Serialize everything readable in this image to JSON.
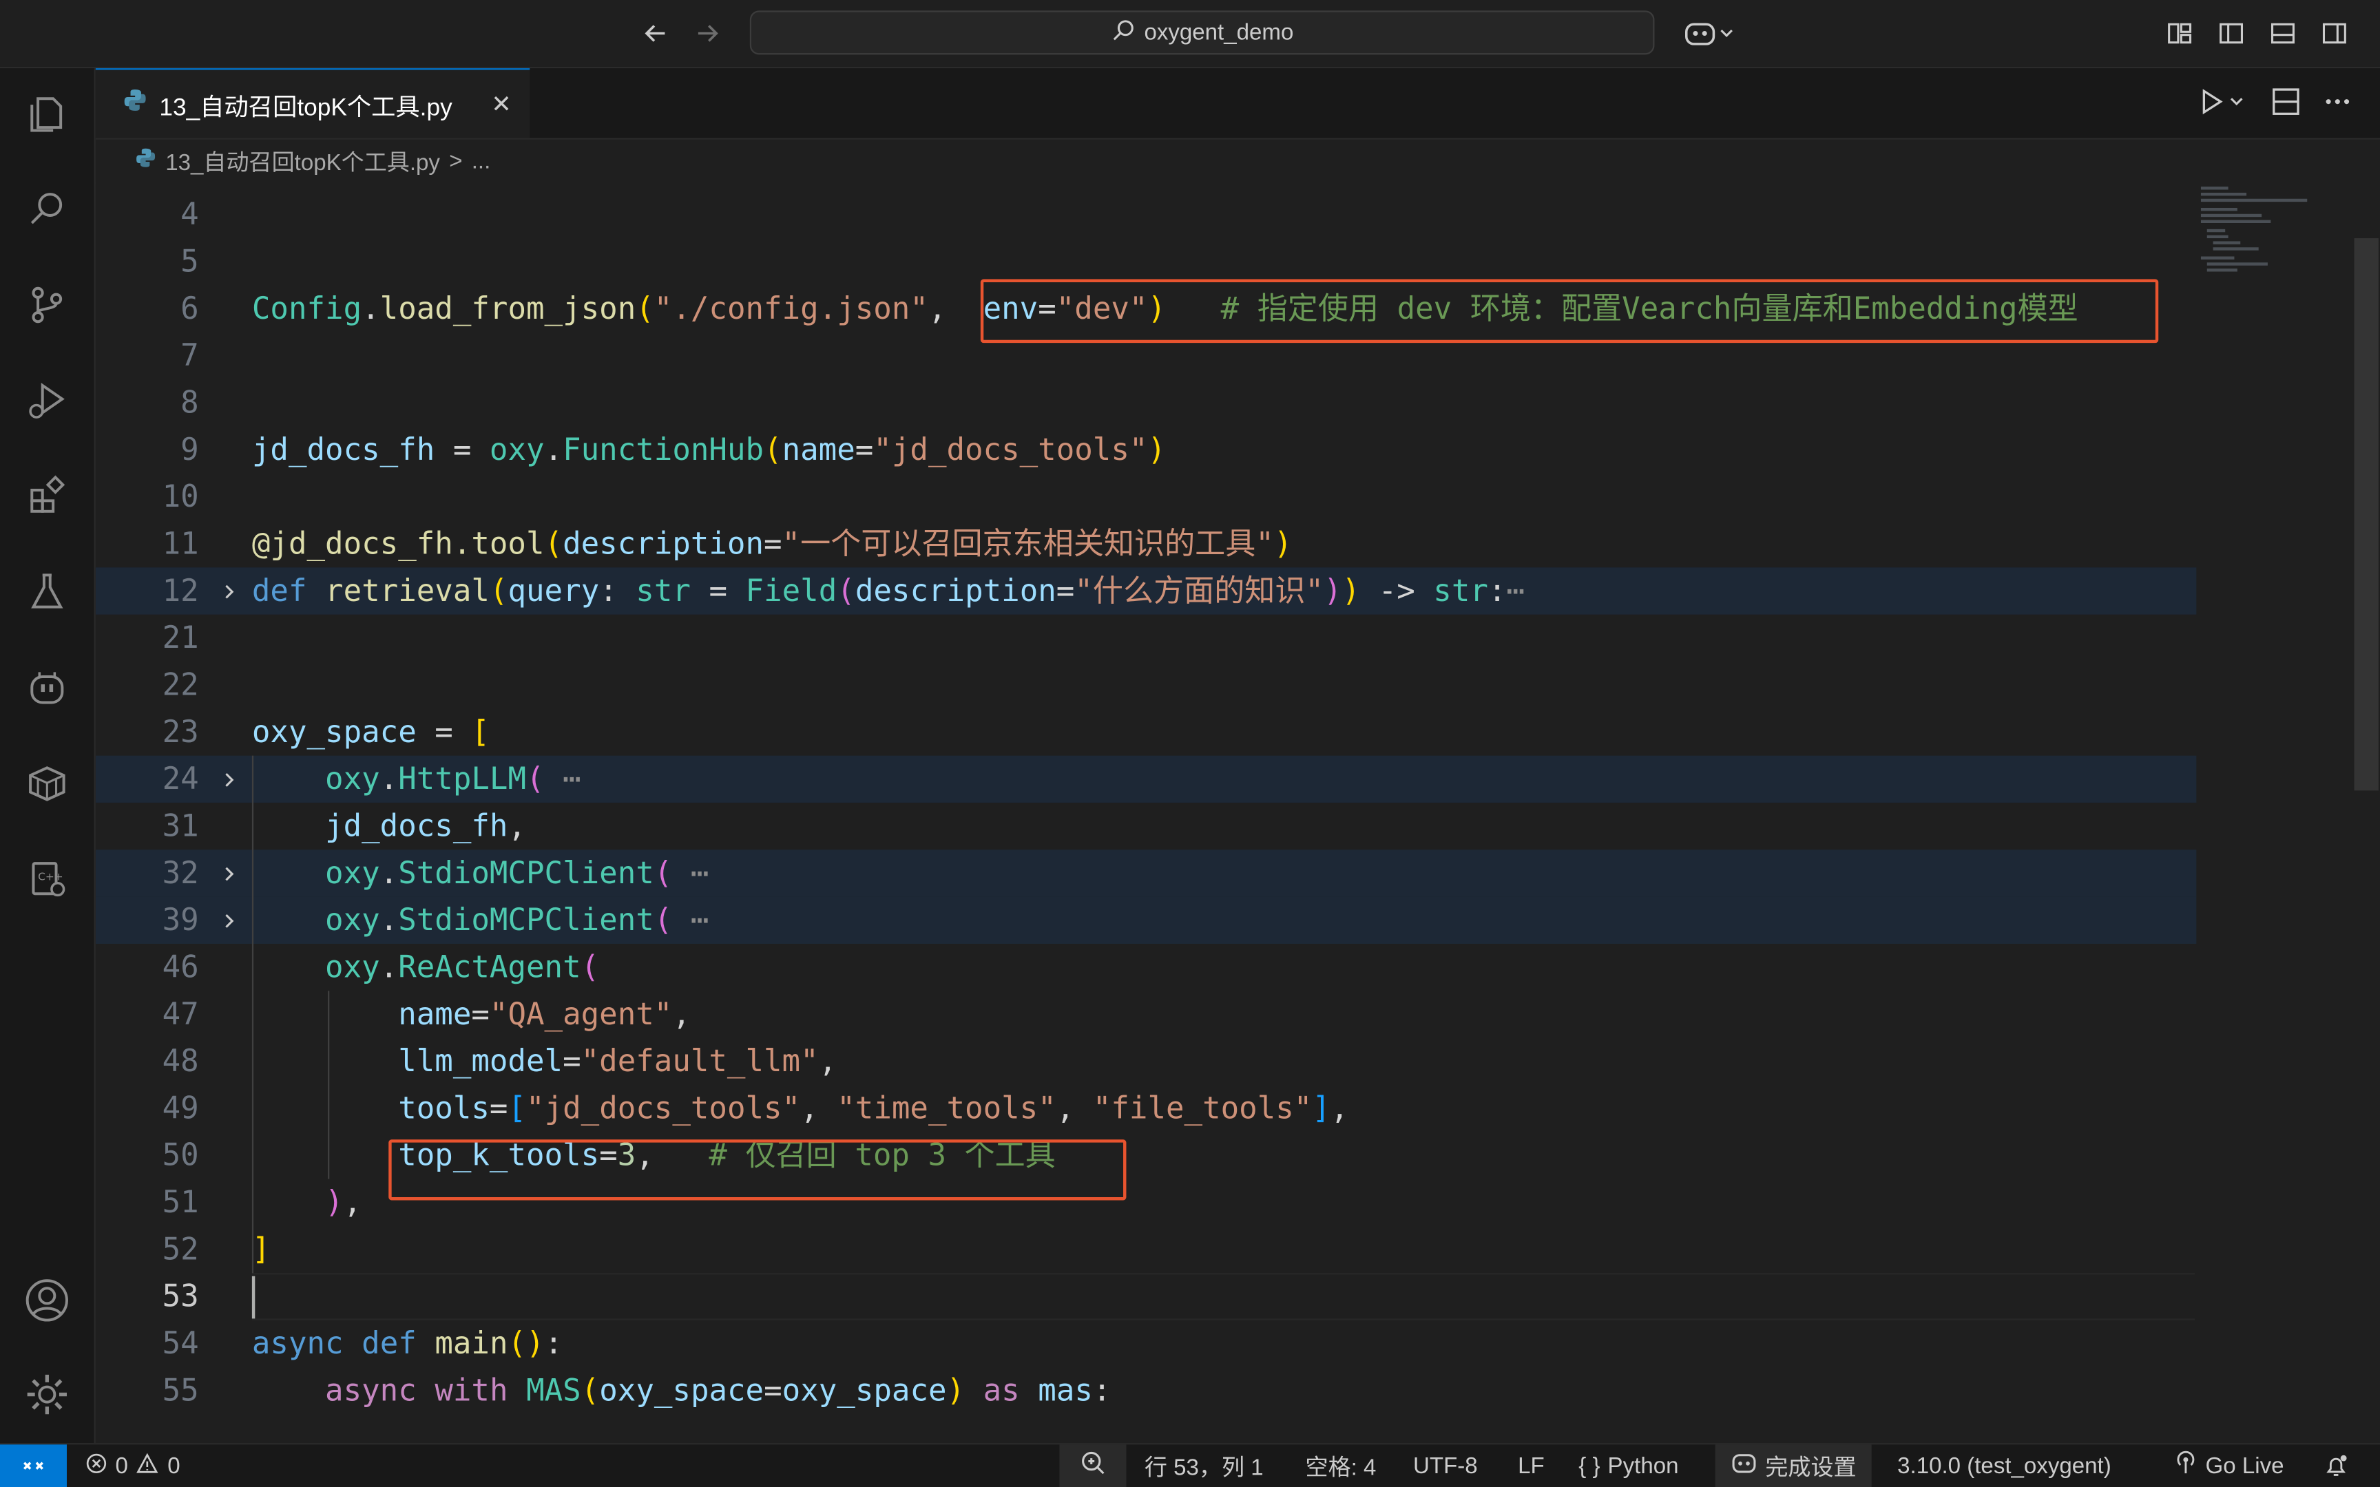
{
  "window": {
    "search_text": "oxygent_demo"
  },
  "tab": {
    "filename": "13_自动召回topK个工具.py",
    "close_glyph": "✕"
  },
  "breadcrumb": {
    "file": "13_自动召回topK个工具.py",
    "separator": ">",
    "more": "..."
  },
  "editor": {
    "lines": [
      {
        "num": "4"
      },
      {
        "num": "5"
      },
      {
        "num": "6"
      },
      {
        "num": "7"
      },
      {
        "num": "8"
      },
      {
        "num": "9"
      },
      {
        "num": "10"
      },
      {
        "num": "11"
      },
      {
        "num": "12"
      },
      {
        "num": "21"
      },
      {
        "num": "22"
      },
      {
        "num": "23"
      },
      {
        "num": "24"
      },
      {
        "num": "31"
      },
      {
        "num": "32"
      },
      {
        "num": "39"
      },
      {
        "num": "46"
      },
      {
        "num": "47"
      },
      {
        "num": "48"
      },
      {
        "num": "49"
      },
      {
        "num": "50"
      },
      {
        "num": "51"
      },
      {
        "num": "52"
      },
      {
        "num": "53"
      },
      {
        "num": "54"
      },
      {
        "num": "55"
      }
    ],
    "code": {
      "l6_cls": "Config",
      "l6_dot": ".",
      "l6_fn": "load_from_json",
      "l6_p": "(",
      "l6_str": "\"./config.json\"",
      "l6_comma": ", ",
      "l6_env": "env",
      "l6_eq": "=",
      "l6_dev": "\"dev\"",
      "l6_close": ")",
      "l6_comment": "# 指定使用 dev 环境：配置Vearch向量库和Embedding模型",
      "l9_var": "jd_docs_fh",
      "l9_eq": " = ",
      "l9_mod": "oxy",
      "l9_dot": ".",
      "l9_cls": "FunctionHub",
      "l9_p": "(",
      "l9_arg": "name",
      "l9_eq2": "=",
      "l9_str": "\"jd_docs_tools\"",
      "l9_close": ")",
      "l11_dec": "@jd_docs_fh.tool",
      "l11_p": "(",
      "l11_arg": "description",
      "l11_eq": "=",
      "l11_str": "\"一个可以召回京东相关知识的工具\"",
      "l11_close": ")",
      "l12_def": "def",
      "l12_fn": "retrieval",
      "l12_p": "(",
      "l12_arg": "query",
      "l12_colon": ": ",
      "l12_type": "str",
      "l12_eq": " = ",
      "l12_field": "Field",
      "l12_p2": "(",
      "l12_arg2": "description",
      "l12_eq2": "=",
      "l12_str": "\"什么方面的知识\"",
      "l12_c2": ")",
      "l12_c1": ")",
      "l12_arrow": " -> ",
      "l12_ret": "str",
      "l12_colon2": ":",
      "l12_dots": "⋯",
      "l23_var": "oxy_space",
      "l23_eq": " = ",
      "l23_br": "[",
      "l24_mod": "oxy",
      "l24_dot": ".",
      "l24_cls": "HttpLLM",
      "l24_p": "(",
      "l24_dots": "⋯",
      "l31_var": "jd_docs_fh",
      "l31_comma": ",",
      "l32_mod": "oxy",
      "l32_dot": ".",
      "l32_cls": "StdioMCPClient",
      "l32_p": "(",
      "l32_dots": "⋯",
      "l39_mod": "oxy",
      "l39_dot": ".",
      "l39_cls": "StdioMCPClient",
      "l39_p": "(",
      "l39_dots": "⋯",
      "l46_mod": "oxy",
      "l46_dot": ".",
      "l46_cls": "ReActAgent",
      "l46_p": "(",
      "l47_arg": "name",
      "l47_eq": "=",
      "l47_str": "\"QA_agent\"",
      "l47_comma": ",",
      "l48_arg": "llm_model",
      "l48_eq": "=",
      "l48_str": "\"default_llm\"",
      "l48_comma": ",",
      "l49_arg": "tools",
      "l49_eq": "=",
      "l49_br": "[",
      "l49_s1": "\"jd_docs_tools\"",
      "l49_c1": ", ",
      "l49_s2": "\"time_tools\"",
      "l49_c2": ", ",
      "l49_s3": "\"file_tools\"",
      "l49_br2": "]",
      "l49_comma": ",",
      "l50_arg": "top_k_tools",
      "l50_eq": "=",
      "l50_num": "3",
      "l50_comma": ",",
      "l50_comment": "# 仅召回 top 3 个工具",
      "l51_close": ")",
      "l51_comma": ",",
      "l52_br": "]",
      "l54_async": "async",
      "l54_def": "def",
      "l54_fn": "main",
      "l54_p": "()",
      "l54_colon": ":",
      "l55_async": "async",
      "l55_with": "with",
      "l55_cls": "MAS",
      "l55_p": "(",
      "l55_arg": "oxy_space",
      "l55_eq": "=",
      "l55_val": "oxy_space",
      "l55_close": ")",
      "l55_as": "as",
      "l55_var": "mas",
      "l55_colon": ":"
    }
  },
  "statusbar": {
    "errors": "0",
    "warnings": "0",
    "position": "行 53，列 1",
    "spaces": "空格: 4",
    "encoding": "UTF-8",
    "eol": "LF",
    "language": "Python",
    "copilot": "完成设置",
    "interpreter": "3.10.0 (test_oxygent)",
    "golive": "Go Live"
  },
  "colors": {
    "accent": "#0078d4",
    "highlight_box": "#e8542f"
  }
}
